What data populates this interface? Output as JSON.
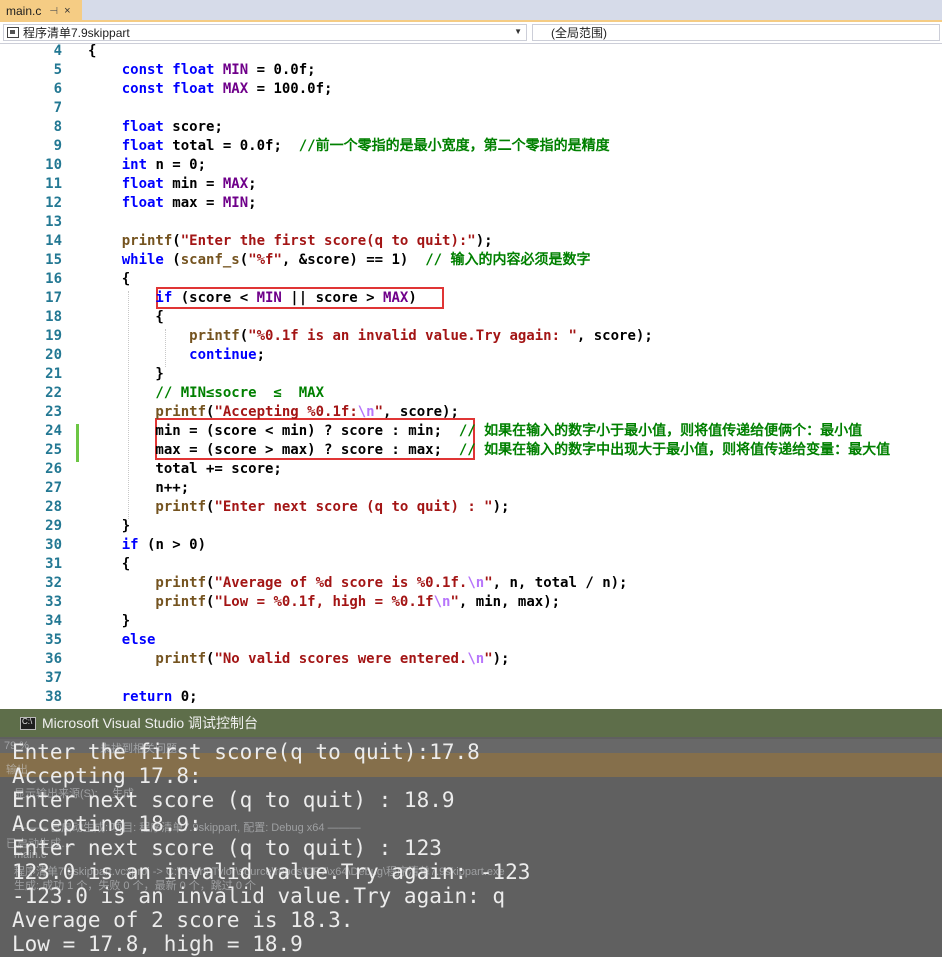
{
  "tab": {
    "title": "main.c",
    "pin": "⊣",
    "close": "×"
  },
  "navbar": {
    "project": "程序清单7.9skippart",
    "scope": "(全局范围)"
  },
  "editor": {
    "line_numbers": [
      "4",
      "5",
      "6",
      "7",
      "8",
      "9",
      "10",
      "11",
      "12",
      "13",
      "14",
      "15",
      "16",
      "17",
      "18",
      "19",
      "20",
      "21",
      "22",
      "23",
      "24",
      "25",
      "26",
      "27",
      "28",
      "29",
      "30",
      "31",
      "32",
      "33",
      "34",
      "35",
      "36",
      "37",
      "38"
    ],
    "lines": [
      [
        [
          "p",
          "{"
        ]
      ],
      [
        [
          "kw",
          "    const float "
        ],
        [
          "id",
          "MIN"
        ],
        [
          "p",
          " = 0.0f;"
        ]
      ],
      [
        [
          "kw",
          "    const float "
        ],
        [
          "id",
          "MAX"
        ],
        [
          "p",
          " = 100.0f;"
        ]
      ],
      [
        [
          "p",
          ""
        ]
      ],
      [
        [
          "kw",
          "    float "
        ],
        [
          "p",
          "score;"
        ]
      ],
      [
        [
          "kw",
          "    float "
        ],
        [
          "p",
          "total = 0.0f;  "
        ],
        [
          "cmt",
          "//前一个零指的是最小宽度，第二个零指的是精度"
        ]
      ],
      [
        [
          "kw",
          "    int "
        ],
        [
          "p",
          "n = 0;"
        ]
      ],
      [
        [
          "kw",
          "    float "
        ],
        [
          "p",
          "min = "
        ],
        [
          "id",
          "MAX"
        ],
        [
          "p",
          ";"
        ]
      ],
      [
        [
          "kw",
          "    float "
        ],
        [
          "p",
          "max = "
        ],
        [
          "id",
          "MIN"
        ],
        [
          "p",
          ";"
        ]
      ],
      [
        [
          "p",
          ""
        ]
      ],
      [
        [
          "fn",
          "    printf"
        ],
        [
          "p",
          "("
        ],
        [
          "str",
          "\"Enter the first score(q to quit):\""
        ],
        [
          "p",
          ");"
        ]
      ],
      [
        [
          "kw",
          "    while "
        ],
        [
          "p",
          "("
        ],
        [
          "fn",
          "scanf_s"
        ],
        [
          "p",
          "("
        ],
        [
          "str",
          "\"%f\""
        ],
        [
          "p",
          ", &score) == 1)  "
        ],
        [
          "cmt",
          "// 输入的内容必须是数字"
        ]
      ],
      [
        [
          "p",
          "    {"
        ]
      ],
      [
        [
          "kw",
          "        if "
        ],
        [
          "p",
          "(score < "
        ],
        [
          "id",
          "MIN"
        ],
        [
          "p",
          " || score > "
        ],
        [
          "id",
          "MAX"
        ],
        [
          "p",
          ")"
        ]
      ],
      [
        [
          "p",
          "        {"
        ]
      ],
      [
        [
          "fn",
          "            printf"
        ],
        [
          "p",
          "("
        ],
        [
          "str",
          "\"%0.1f is an invalid value.Try again: \""
        ],
        [
          "p",
          ", score);"
        ]
      ],
      [
        [
          "kw",
          "            continue"
        ],
        [
          "p",
          ";"
        ]
      ],
      [
        [
          "p",
          "        }"
        ]
      ],
      [
        [
          "cmt",
          "        // MIN≤socre  ≤  MAX"
        ]
      ],
      [
        [
          "fn",
          "        printf"
        ],
        [
          "p",
          "("
        ],
        [
          "str",
          "\"Accepting %0.1f:"
        ],
        [
          "esc",
          "\\n"
        ],
        [
          "str",
          "\""
        ],
        [
          "p",
          ", score);"
        ]
      ],
      [
        [
          "p",
          "        min = (score < min) ? score : min;  "
        ],
        [
          "cmt",
          "// 如果在输入的数字小于最小值，则将值传递给便俩个：最小值"
        ]
      ],
      [
        [
          "p",
          "        max = (score > max) ? score : max;  "
        ],
        [
          "cmt",
          "// 如果在输入的数字中出现大于最小值，则将值传递给变量：最大值"
        ]
      ],
      [
        [
          "p",
          "        total += score;"
        ]
      ],
      [
        [
          "p",
          "        n++;"
        ]
      ],
      [
        [
          "fn",
          "        printf"
        ],
        [
          "p",
          "("
        ],
        [
          "str",
          "\"Enter next score (q to quit) : \""
        ],
        [
          "p",
          ");"
        ]
      ],
      [
        [
          "p",
          "    }"
        ]
      ],
      [
        [
          "kw",
          "    if "
        ],
        [
          "p",
          "(n > 0)"
        ]
      ],
      [
        [
          "p",
          "    {"
        ]
      ],
      [
        [
          "fn",
          "        printf"
        ],
        [
          "p",
          "("
        ],
        [
          "str",
          "\"Average of %d score is %0.1f."
        ],
        [
          "esc",
          "\\n"
        ],
        [
          "str",
          "\""
        ],
        [
          "p",
          ", n, total / n);"
        ]
      ],
      [
        [
          "fn",
          "        printf"
        ],
        [
          "p",
          "("
        ],
        [
          "str",
          "\"Low = %0.1f, high = %0.1f"
        ],
        [
          "esc",
          "\\n"
        ],
        [
          "str",
          "\""
        ],
        [
          "p",
          ", min, max);"
        ]
      ],
      [
        [
          "p",
          "    }"
        ]
      ],
      [
        [
          "kw",
          "    else"
        ]
      ],
      [
        [
          "fn",
          "        printf"
        ],
        [
          "p",
          "("
        ],
        [
          "str",
          "\"No valid scores were entered."
        ],
        [
          "esc",
          "\\n"
        ],
        [
          "str",
          "\""
        ],
        [
          "p",
          ");"
        ]
      ],
      [
        [
          "p",
          ""
        ]
      ],
      [
        [
          "kw",
          "    return "
        ],
        [
          "p",
          "0;"
        ]
      ]
    ]
  },
  "console": {
    "title": "Microsoft Visual Studio 调试控制台",
    "lines": [
      "Enter the first score(q to quit):17.8",
      "Accepting 17.8:",
      "Enter next score (q to quit) : 18.9",
      "Accepting 18.9:",
      "Enter next score (q to quit) : 123",
      "123.0 is an invalid value.Try again: -123",
      "-123.0 is an invalid value.Try again: q",
      "Average of 2 score is 18.3.",
      "Low = 17.8, high = 18.9"
    ]
  },
  "background_panel": {
    "zoom": "79 %",
    "issues": "未找到相关问题",
    "output_label": "输出",
    "show_output_from": "显示输出来源(S):",
    "source": "生成",
    "build_start": "已启动生成…",
    "build_line": "——— 已启动生成: 项目: 程序清单7.9skippart, 配置: Debug x64 ———",
    "main_c": "main.c",
    "exe_line": "程序清单7.9skippart.vcxproj -> C:\\Users\\Tylor\\source\\repos\\CP7\\x64\\Debug\\程序清单7.9skippart.exe",
    "summary": "生成: 成功 1 个，失败 0 个，最新 0 个，跳过 0 个"
  }
}
